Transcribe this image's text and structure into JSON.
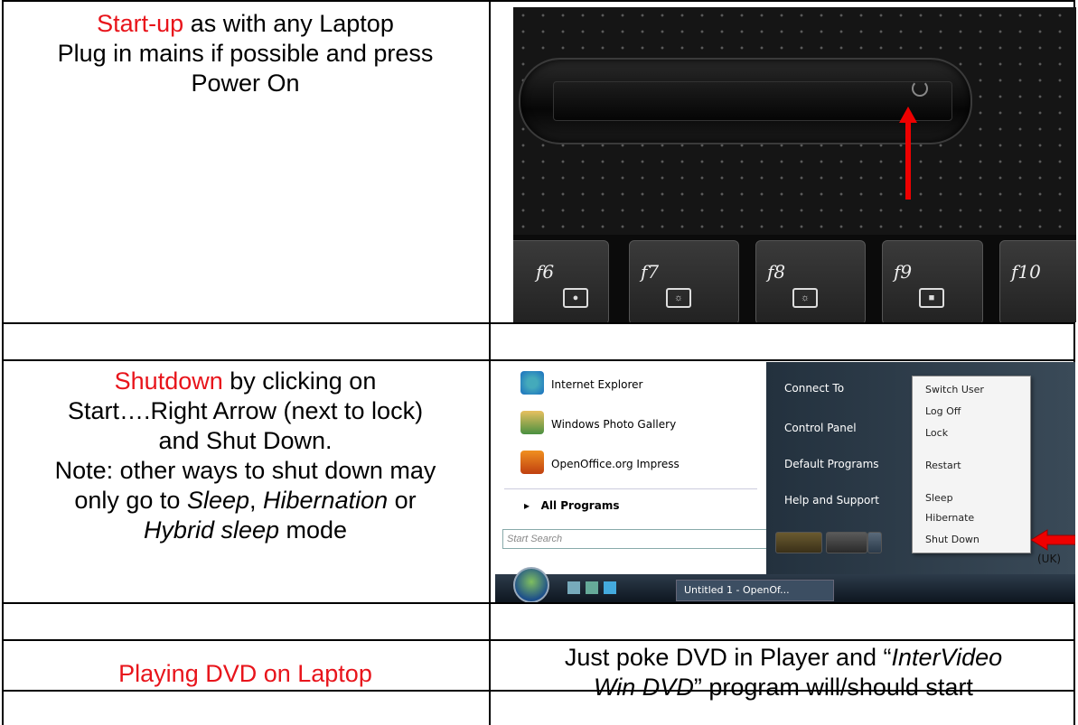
{
  "row1": {
    "heading": "Start-up",
    "line1_rest": " as with any Laptop",
    "line2": "Plug in mains if possible and press",
    "line3": "Power On"
  },
  "keyboard": {
    "keys": [
      "f6",
      "f7",
      "f8",
      "f9",
      "f10"
    ]
  },
  "row2": {
    "heading": "Shutdown",
    "line1_rest": " by clicking on",
    "line2": "Start….Right Arrow (next to lock)",
    "line3": "and Shut Down.",
    "line4": "Note: other ways to shut down may",
    "line5_pre": "only go to ",
    "sleep": "Sleep",
    "comma": ", ",
    "hibernation": "Hibernation",
    "or": " or",
    "hybrid": "Hybrid sleep",
    "mode": " mode"
  },
  "start_menu": {
    "left_items": [
      "Internet Explorer",
      "Windows Photo Gallery",
      "OpenOffice.org Impress"
    ],
    "all_programs": "All Programs",
    "search_placeholder": "Start Search",
    "right_items": [
      "Connect To",
      "Control Panel",
      "Default Programs",
      "Help and Support"
    ],
    "popup_items": [
      "Switch User",
      "Log Off",
      "Lock",
      "Restart",
      "Sleep",
      "Hibernate",
      "Shut Down"
    ],
    "taskbar_item": "Untitled 1 - OpenOf...",
    "lang": "(UK)"
  },
  "row3": {
    "left": "Playing DVD on Laptop",
    "right_pre": "Just poke DVD in Player and “",
    "right_em1": "InterVideo",
    "right_em2": "Win DVD",
    "right_post": "” program will/should start"
  },
  "colors": {
    "accent_red": "#e8141b"
  }
}
